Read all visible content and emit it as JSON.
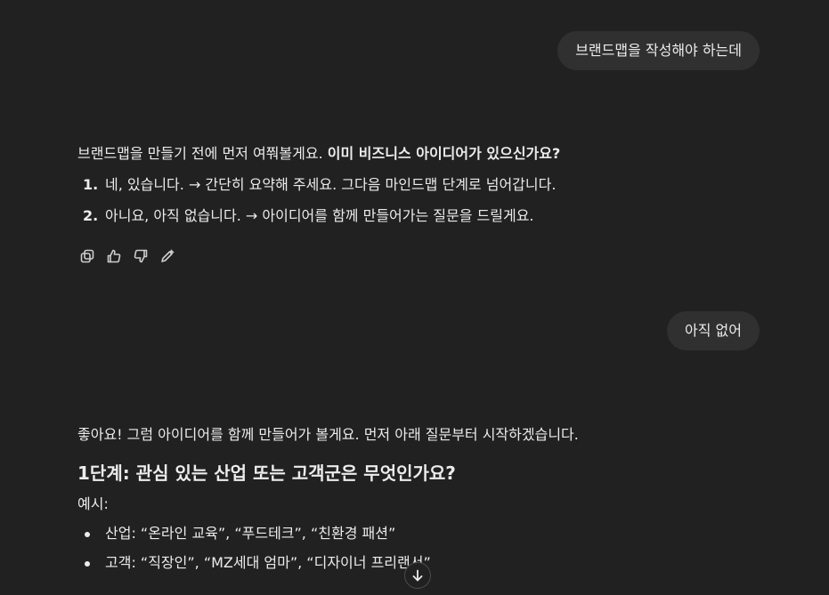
{
  "messages": {
    "user1": "브랜드맵을 작성해야 하는데",
    "assistant1": {
      "intro": "브랜드맵을 만들기 전에 먼저 여쭤볼게요. ",
      "intro_bold": "이미 비즈니스 아이디어가 있으신가요?",
      "options": [
        {
          "num": "1.",
          "text": "네, 있습니다. → 간단히 요약해 주세요. 그다음 마인드맵 단계로 넘어갑니다."
        },
        {
          "num": "2.",
          "text": "아니요, 아직 없습니다. → 아이디어를 함께 만들어가는 질문을 드릴게요."
        }
      ]
    },
    "user2": "아직 없어",
    "assistant2": {
      "intro": "좋아요! 그럼 아이디어를 함께 만들어가 볼게요. 먼저 아래 질문부터 시작하겠습니다.",
      "heading": "1단계: 관심 있는 산업 또는 고객군은 무엇인가요?",
      "examples_label": "예시:",
      "examples": [
        "산업: “온라인 교육”, “푸드테크”, “친환경 패션”",
        "고객: “직장인”, “MZ세대 엄마”, “디자이너 프리랜서”"
      ]
    }
  },
  "action_icons": [
    "copy-icon",
    "thumbs-up-icon",
    "thumbs-down-icon",
    "edit-icon"
  ],
  "scroll_icon": "arrow-down-icon"
}
